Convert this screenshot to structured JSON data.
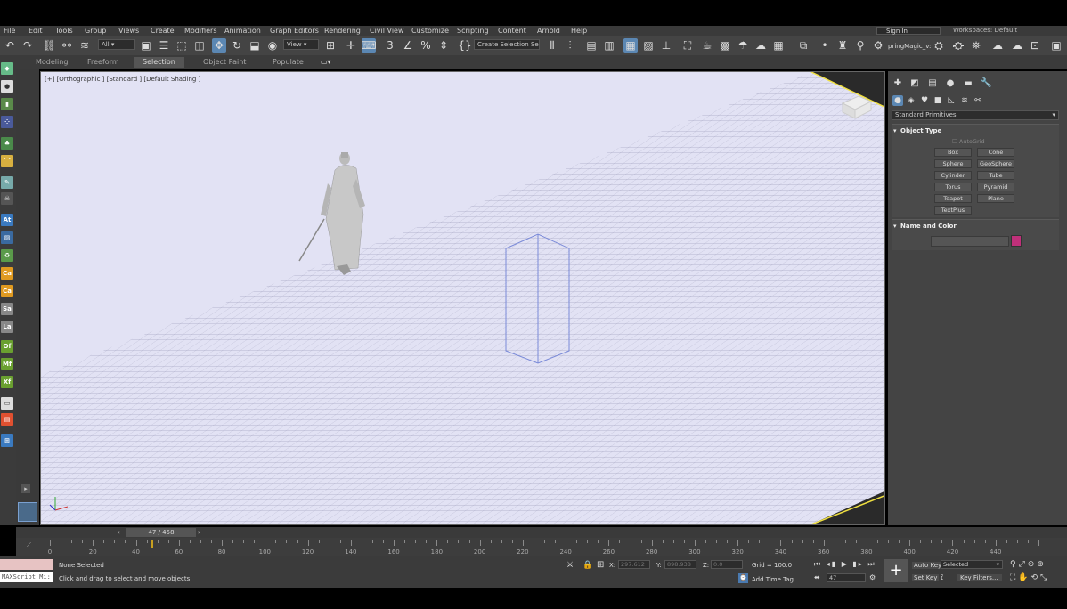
{
  "menu": [
    "File",
    "Edit",
    "Tools",
    "Group",
    "Views",
    "Create",
    "Modifiers",
    "Animation",
    "Graph Editors",
    "Rendering",
    "Civil View",
    "Customize",
    "Scripting",
    "Content",
    "Arnold",
    "Help"
  ],
  "account": {
    "sign_in": "Sign In",
    "workspaces": "Workspaces: Default"
  },
  "toolbar": {
    "filter": "All",
    "view_dropdown": "View",
    "selection_set": "Create Selection Se",
    "springmagic": "pringMagic_v:"
  },
  "ribbon_tabs": [
    "Modeling",
    "Freeform",
    "Selection",
    "Object Paint",
    "Populate"
  ],
  "left_icons": [
    "At",
    "Ca",
    "Ca",
    "Sa",
    "La",
    "Of",
    "Mf",
    "Xf"
  ],
  "viewport": {
    "label": "[+] [Orthographic ] [Standard ] [Default Shading ]"
  },
  "command_panel": {
    "category": "Standard Primitives",
    "object_type_title": "Object Type",
    "autogrid": "AutoGrid",
    "buttons": [
      "Box",
      "Cone",
      "Sphere",
      "GeoSphere",
      "Cylinder",
      "Tube",
      "Torus",
      "Pyramid",
      "Teapot",
      "Plane",
      "TextPlus"
    ],
    "name_color_title": "Name and Color",
    "swatch_color": "#c0307a"
  },
  "time": {
    "frame_display": "47 / 458",
    "ticks": [
      "0",
      "20",
      "40",
      "60",
      "80",
      "100",
      "120",
      "140",
      "160",
      "180",
      "200",
      "220",
      "240",
      "260",
      "280",
      "300",
      "320",
      "340",
      "360",
      "380",
      "400",
      "420",
      "440"
    ],
    "current_frame": 47,
    "total_frames": 458
  },
  "status": {
    "maxscript": "MAXScript Mi:",
    "selection": "None Selected",
    "prompt": "Click and drag to select and move objects",
    "x_label": "X:",
    "x_value": "297.612",
    "y_label": "Y:",
    "y_value": "898.938",
    "z_label": "Z:",
    "z_value": "0.0",
    "grid": "Grid = 100.0",
    "add_time_tag": "Add Time Tag",
    "frame_field": "47",
    "auto_key": "Auto Key",
    "set_key": "Set Key",
    "selected": "Selected",
    "key_filters": "Key Filters..."
  }
}
